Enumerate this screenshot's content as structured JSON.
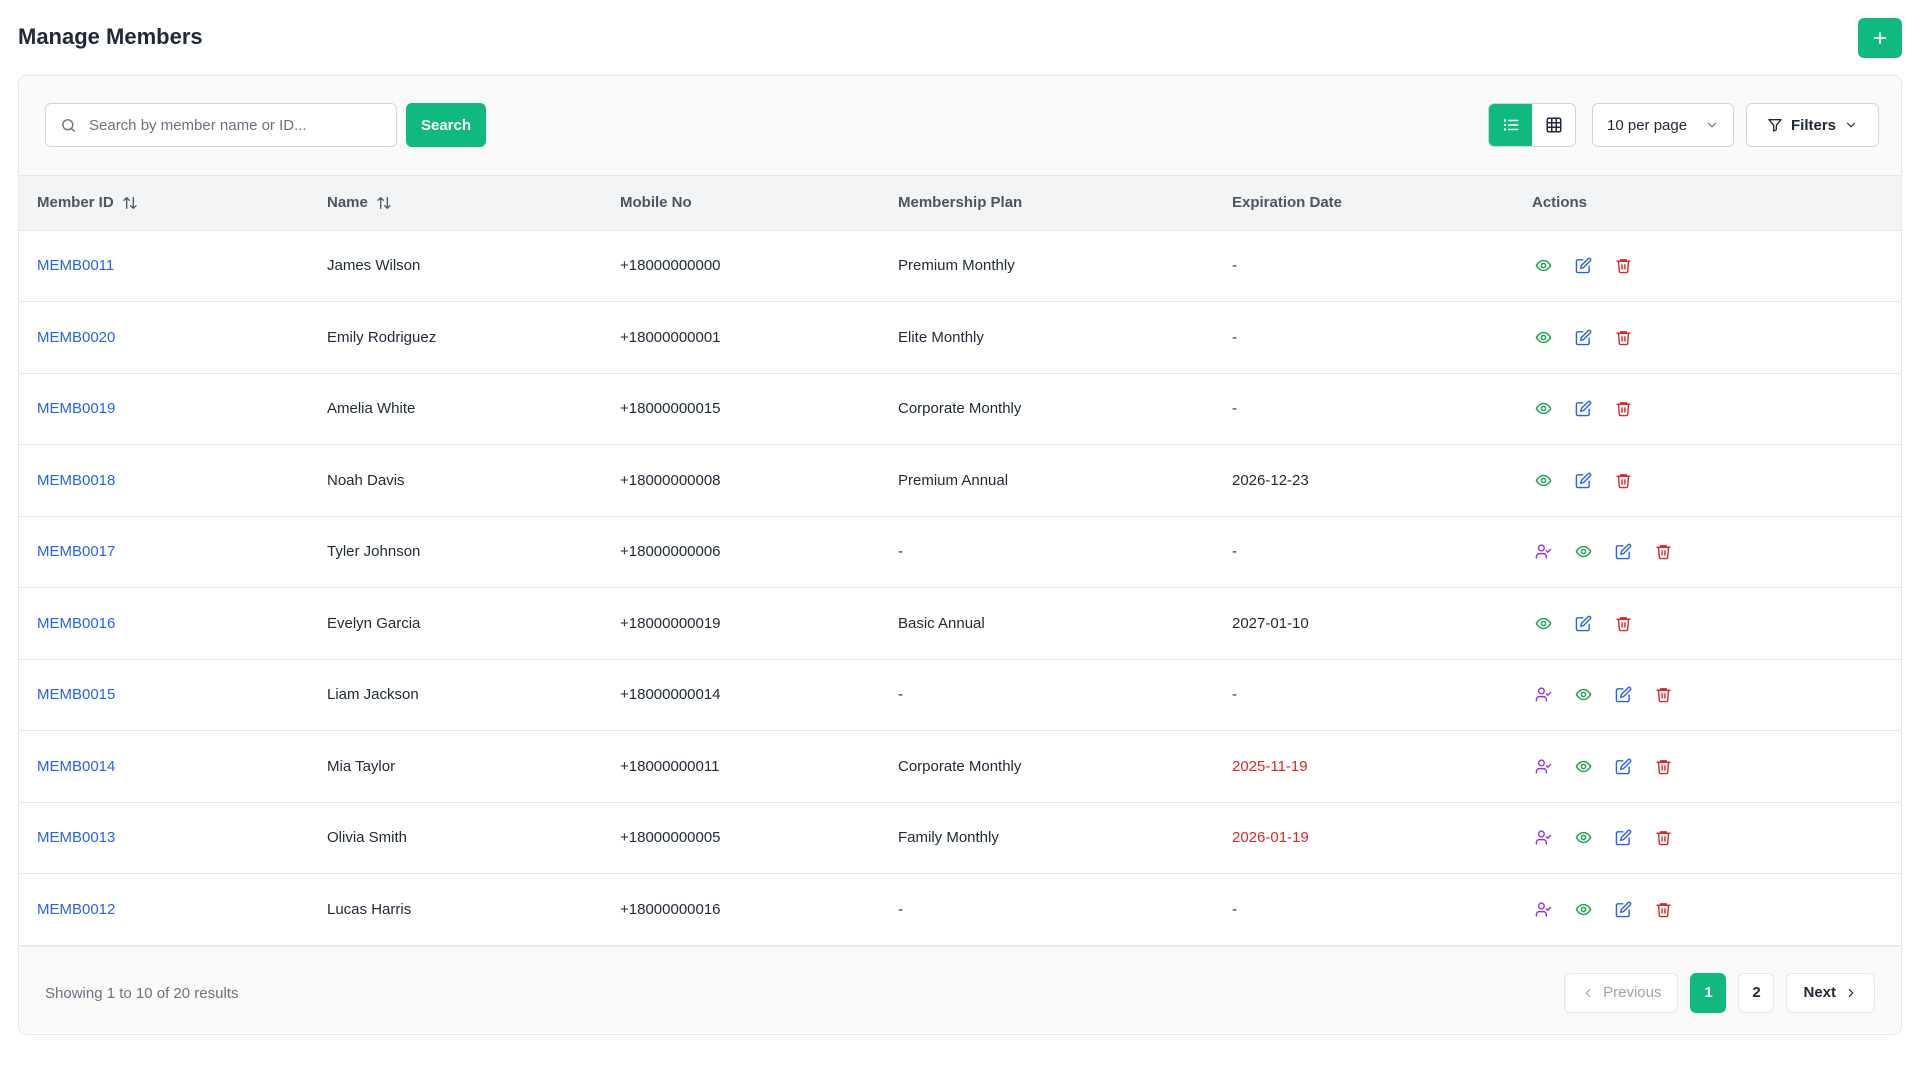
{
  "page": {
    "title": "Manage Members",
    "add_button_icon": "plus-icon"
  },
  "toolbar": {
    "search_placeholder": "Search by member name or ID...",
    "search_value": "",
    "search_button": "Search",
    "view_mode": "list",
    "per_page": "10 per page",
    "filters_label": "Filters"
  },
  "colors": {
    "accent": "#10b981",
    "link": "#2563eb",
    "danger": "#dc2626",
    "view_icon": "#16a34a",
    "edit_icon": "#2563eb",
    "assign_icon": "#9333ea"
  },
  "table": {
    "columns": [
      "Member ID",
      "Name",
      "Mobile No",
      "Membership Plan",
      "Expiration Date",
      "Actions"
    ],
    "sortable": [
      "Member ID",
      "Name"
    ],
    "rows": [
      {
        "id": "MEMB0011",
        "name": "James Wilson",
        "mobile": "+18000000000",
        "plan": "Premium Monthly",
        "expiration": "-",
        "expired": false,
        "assign": false
      },
      {
        "id": "MEMB0020",
        "name": "Emily Rodriguez",
        "mobile": "+18000000001",
        "plan": "Elite Monthly",
        "expiration": "-",
        "expired": false,
        "assign": false
      },
      {
        "id": "MEMB0019",
        "name": "Amelia White",
        "mobile": "+18000000015",
        "plan": "Corporate Monthly",
        "expiration": "-",
        "expired": false,
        "assign": false
      },
      {
        "id": "MEMB0018",
        "name": "Noah Davis",
        "mobile": "+18000000008",
        "plan": "Premium Annual",
        "expiration": "2026-12-23",
        "expired": false,
        "assign": false
      },
      {
        "id": "MEMB0017",
        "name": "Tyler Johnson",
        "mobile": "+18000000006",
        "plan": "-",
        "expiration": "-",
        "expired": false,
        "assign": true
      },
      {
        "id": "MEMB0016",
        "name": "Evelyn Garcia",
        "mobile": "+18000000019",
        "plan": "Basic Annual",
        "expiration": "2027-01-10",
        "expired": false,
        "assign": false
      },
      {
        "id": "MEMB0015",
        "name": "Liam Jackson",
        "mobile": "+18000000014",
        "plan": "-",
        "expiration": "-",
        "expired": false,
        "assign": true
      },
      {
        "id": "MEMB0014",
        "name": "Mia Taylor",
        "mobile": "+18000000011",
        "plan": "Corporate Monthly",
        "expiration": "2025-11-19",
        "expired": true,
        "assign": true
      },
      {
        "id": "MEMB0013",
        "name": "Olivia Smith",
        "mobile": "+18000000005",
        "plan": "Family Monthly",
        "expiration": "2026-01-19",
        "expired": true,
        "assign": true
      },
      {
        "id": "MEMB0012",
        "name": "Lucas Harris",
        "mobile": "+18000000016",
        "plan": "-",
        "expiration": "-",
        "expired": false,
        "assign": true
      }
    ]
  },
  "footer": {
    "showing": "Showing 1 to 10 of 20 results",
    "previous": "Previous",
    "next": "Next",
    "pages": [
      "1",
      "2"
    ],
    "current_page": "1"
  }
}
